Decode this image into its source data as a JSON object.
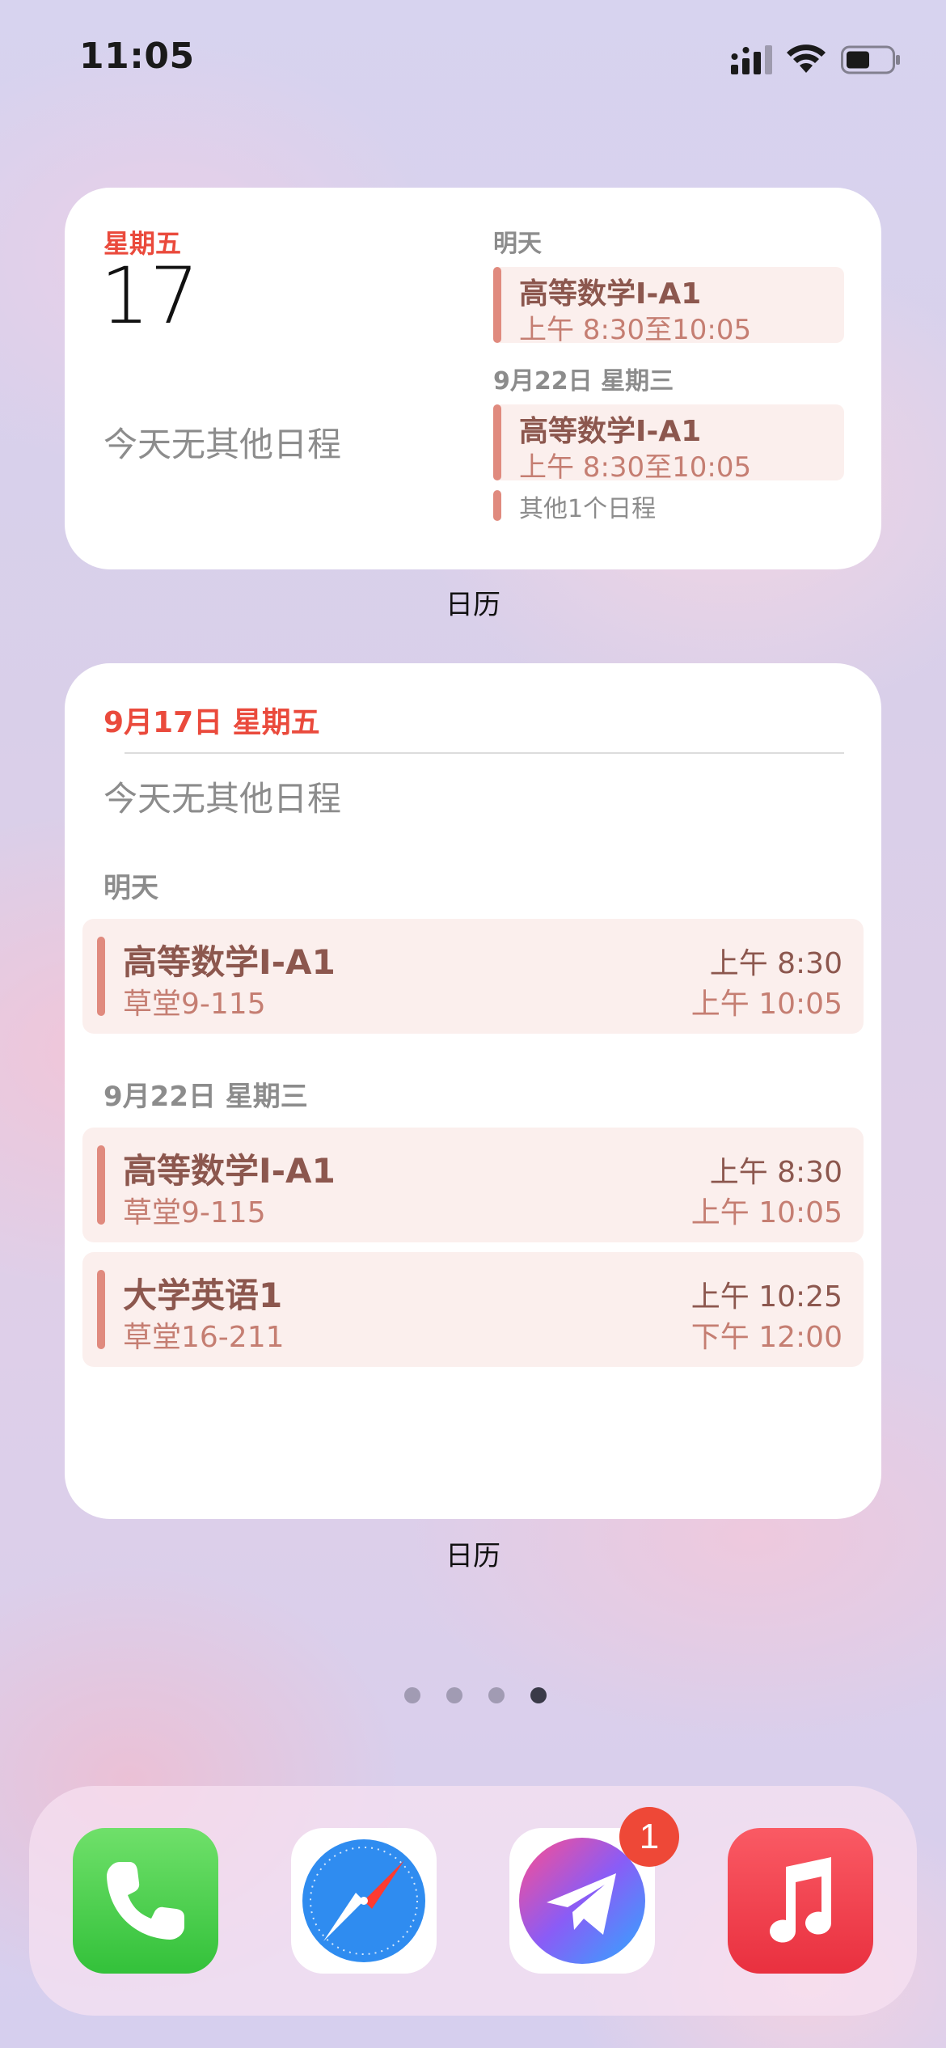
{
  "status_bar": {
    "time": "11:05"
  },
  "widget_small": {
    "weekday": "星期五",
    "day": "17",
    "no_events": "今天无其他日程",
    "section1": "明天",
    "event1": {
      "title": "高等数学I-A1",
      "time": "上午 8:30至10:05"
    },
    "section2": "9月22日 星期三",
    "event2": {
      "title": "高等数学I-A1",
      "time": "上午 8:30至10:05"
    },
    "more": "其他1个日程",
    "label": "日历"
  },
  "widget_large": {
    "date_header": "9月17日 星期五",
    "no_events": "今天无其他日程",
    "section1": "明天",
    "events1": [
      {
        "title": "高等数学I-A1",
        "location": "草堂9-115",
        "start": "上午 8:30",
        "end": "上午 10:05"
      }
    ],
    "section2": "9月22日 星期三",
    "events2": [
      {
        "title": "高等数学I-A1",
        "location": "草堂9-115",
        "start": "上午 8:30",
        "end": "上午 10:05"
      },
      {
        "title": "大学英语1",
        "location": "草堂16-211",
        "start": "上午 10:25",
        "end": "下午 12:00"
      }
    ],
    "label": "日历"
  },
  "page_dots": {
    "count": 4,
    "active_index": 3
  },
  "dock": {
    "apps": [
      {
        "icon": "phone-icon"
      },
      {
        "icon": "safari-icon"
      },
      {
        "icon": "telegram-icon",
        "badge": "1"
      },
      {
        "icon": "music-icon"
      }
    ]
  },
  "colors": {
    "accent_red": "#ea4a3c",
    "event_bar": "#e08a7e",
    "event_bg": "#fbefed"
  }
}
